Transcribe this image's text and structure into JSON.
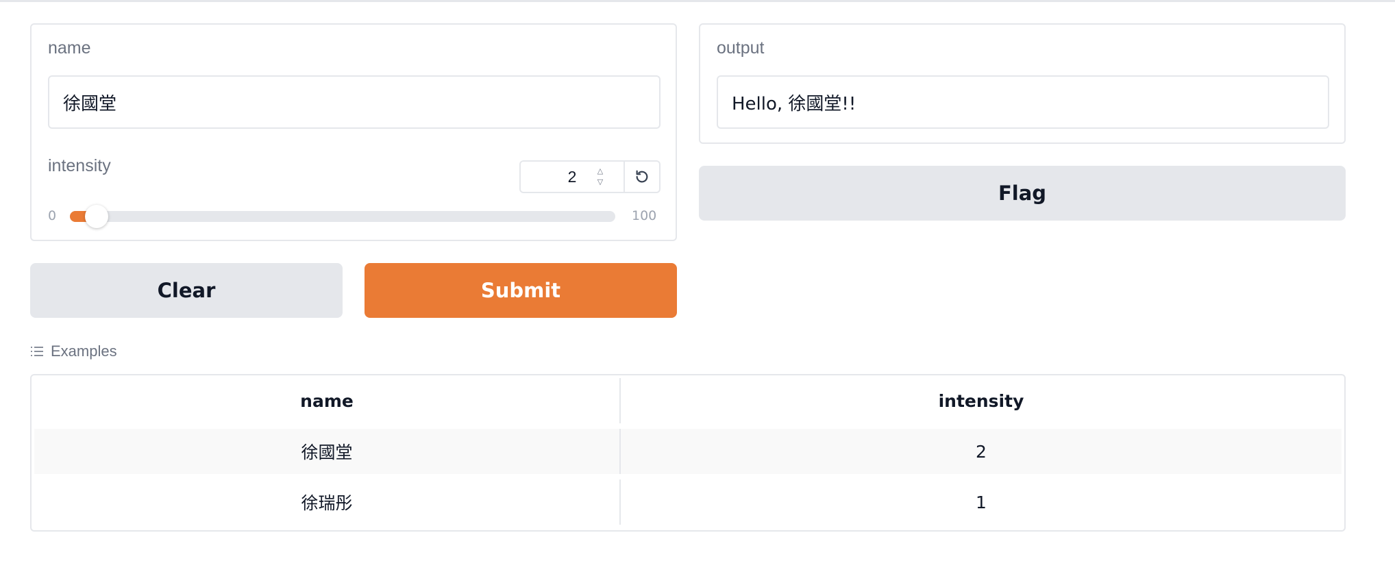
{
  "input": {
    "name_label": "name",
    "name_value": "徐國堂",
    "intensity_label": "intensity",
    "intensity_value": "2",
    "slider_min": "0",
    "slider_max": "100",
    "slider_level": 2
  },
  "output": {
    "label": "output",
    "value": "Hello, 徐國堂!!"
  },
  "buttons": {
    "clear": "Clear",
    "submit": "Submit",
    "flag": "Flag"
  },
  "examples": {
    "label": "Examples",
    "headers": [
      "name",
      "intensity"
    ],
    "rows": [
      [
        "徐國堂",
        "2"
      ],
      [
        "徐瑞彤",
        "1"
      ]
    ]
  },
  "colors": {
    "accent": "#ea7b35",
    "secondary_button": "#e5e7eb",
    "border": "#e5e7eb"
  },
  "icons": {
    "reset": "reset-icon",
    "examples": "list-icon",
    "stepper_up": "chevron-up-icon",
    "stepper_down": "chevron-down-icon"
  }
}
